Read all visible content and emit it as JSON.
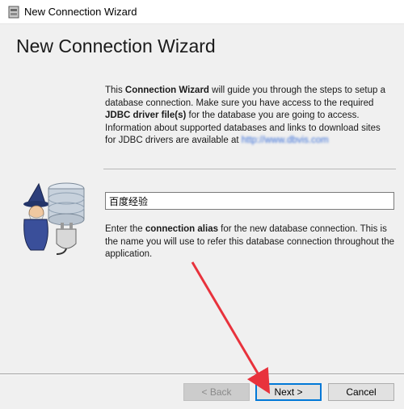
{
  "window": {
    "title": "New Connection Wizard",
    "icon": "app-icon"
  },
  "header": {
    "title": "New Connection Wizard"
  },
  "description": {
    "p1_a": "This ",
    "p1_b": "Connection Wizard",
    "p1_c": " will guide you through the steps to setup a database connection. Make sure you have access to the required ",
    "p1_d": "JDBC driver file(s)",
    "p1_e": " for the database you are going to access.",
    "p2": "Information about supported databases and links to download sites for JDBC drivers are available at ",
    "link": "http://www.dbvis.com"
  },
  "alias_input": {
    "value": "百度经验"
  },
  "hint": {
    "a": "Enter the ",
    "b": "connection alias",
    "c": " for the new database connection. This is the name you will use to refer this database connection throughout the application."
  },
  "buttons": {
    "back": "< Back",
    "next": "Next >",
    "cancel": "Cancel"
  },
  "colors": {
    "accent": "#0078d7",
    "annotation_arrow": "#e8323c",
    "link": "#3a6fd8"
  },
  "icons": {
    "illustration": "wizard-database-plug-icon"
  }
}
